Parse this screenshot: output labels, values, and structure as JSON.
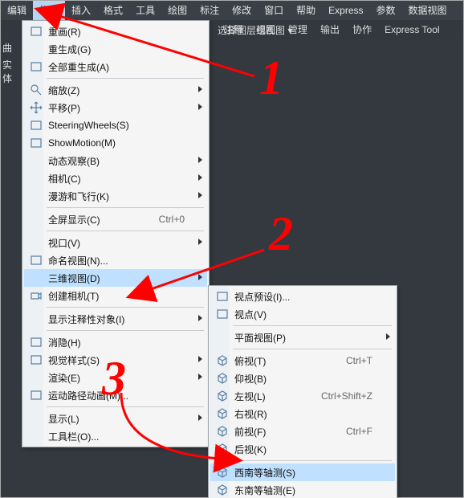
{
  "menubar": {
    "items": [
      "编辑",
      "视图",
      "插入",
      "格式",
      "工具",
      "绘图",
      "标注",
      "修改",
      "窗口",
      "帮助",
      "Express",
      "参数",
      "数据视图"
    ],
    "active_index": 1
  },
  "toolbar": {
    "left": [
      "曲",
      "实体"
    ],
    "items": [
      "注释",
      "视图",
      "管理",
      "输出",
      "协作",
      "Express Tool"
    ],
    "group_items": [
      "选择",
      "图层",
      "组",
      "视图 ▾"
    ]
  },
  "view_menu": {
    "items": [
      {
        "label": "重画(R)",
        "icon": "redraw"
      },
      {
        "label": "重生成(G)"
      },
      {
        "label": "全部重生成(A)",
        "icon": "regen-all"
      },
      {
        "sep": true
      },
      {
        "label": "缩放(Z)",
        "sub": true,
        "icon": "zoom"
      },
      {
        "label": "平移(P)",
        "sub": true,
        "icon": "pan"
      },
      {
        "label": "SteeringWheels(S)",
        "icon": "wheel"
      },
      {
        "label": "ShowMotion(M)",
        "icon": "motion"
      },
      {
        "label": "动态观察(B)",
        "sub": true
      },
      {
        "label": "相机(C)",
        "sub": true
      },
      {
        "label": "漫游和飞行(K)",
        "sub": true
      },
      {
        "sep": true
      },
      {
        "label": "全屏显示(C)",
        "shortcut": "Ctrl+0"
      },
      {
        "sep": true
      },
      {
        "label": "视口(V)",
        "sub": true
      },
      {
        "label": "命名视图(N)...",
        "icon": "named-view"
      },
      {
        "label": "三维视图(D)",
        "sub": true,
        "hover": true
      },
      {
        "label": "创建相机(T)",
        "icon": "camera"
      },
      {
        "sep": true
      },
      {
        "label": "显示注释性对象(I)",
        "sub": true
      },
      {
        "sep": true
      },
      {
        "label": "消隐(H)",
        "icon": "hide"
      },
      {
        "label": "视觉样式(S)",
        "sub": true,
        "icon": "vstyle"
      },
      {
        "label": "渲染(E)",
        "sub": true
      },
      {
        "label": "运动路径动画(M)...",
        "icon": "mpath"
      },
      {
        "sep": true
      },
      {
        "label": "显示(L)",
        "sub": true
      },
      {
        "label": "工具栏(O)..."
      }
    ]
  },
  "submenu_3dview": {
    "items": [
      {
        "label": "视点预设(I)...",
        "icon": "vp-preset"
      },
      {
        "label": "视点(V)",
        "icon": "vp"
      },
      {
        "sep": true
      },
      {
        "label": "平面视图(P)",
        "sub": true
      },
      {
        "sep": true
      },
      {
        "label": "俯视(T)",
        "icon": "cube",
        "shortcut": "Ctrl+T"
      },
      {
        "label": "仰视(B)",
        "icon": "cube"
      },
      {
        "label": "左视(L)",
        "icon": "cube",
        "shortcut": "Ctrl+Shift+Z"
      },
      {
        "label": "右视(R)",
        "icon": "cube"
      },
      {
        "label": "前视(F)",
        "icon": "cube",
        "shortcut": "Ctrl+F"
      },
      {
        "label": "后视(K)",
        "icon": "cube"
      },
      {
        "sep": true
      },
      {
        "label": "西南等轴测(S)",
        "icon": "iso",
        "hover": true
      },
      {
        "label": "东南等轴测(E)",
        "icon": "iso"
      }
    ]
  },
  "annotations": {
    "n1": "1",
    "n2": "2",
    "n3": "3"
  }
}
